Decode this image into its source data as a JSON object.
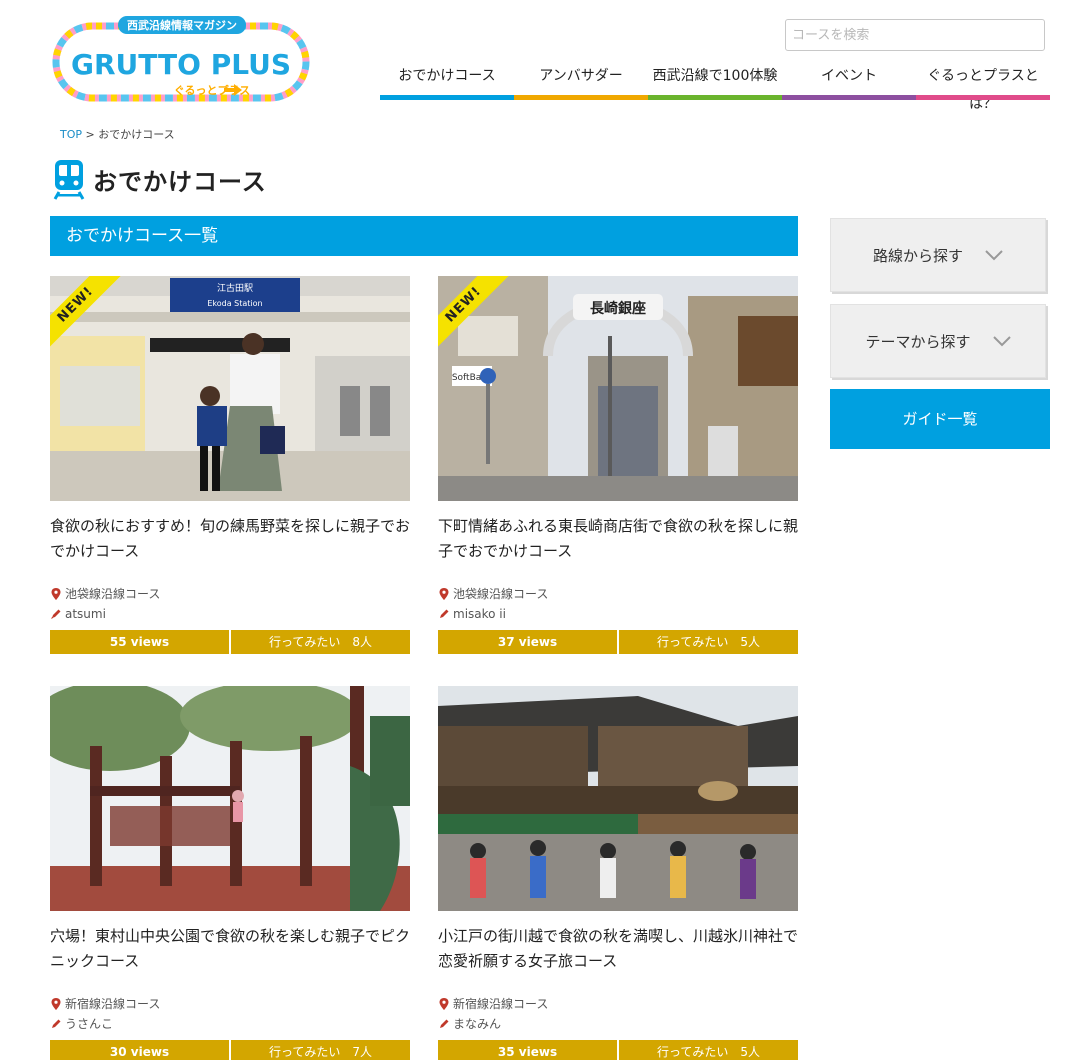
{
  "header": {
    "logo_tagline": "西武沿線情報マガジン",
    "logo_main": "GRUTTO PLUS",
    "logo_sub": "ぐるっとプラス",
    "search_placeholder": "コースを検索"
  },
  "nav": {
    "items": [
      {
        "label": "おでかけコース",
        "color": "#00a0e0"
      },
      {
        "label": "アンバサダー",
        "color": "#f0a800"
      },
      {
        "label": "西武沿線で100体験",
        "color": "#6ab42d"
      },
      {
        "label": "イベント",
        "color": "#8d4fa0"
      },
      {
        "label": "ぐるっとプラスとは？",
        "color": "#e04b8a"
      }
    ]
  },
  "breadcrumb": {
    "top": "TOP",
    "separator": ">",
    "current": "おでかけコース"
  },
  "page": {
    "title": "おでかけコース",
    "section_title": "おでかけコース一覧"
  },
  "cards": [
    {
      "title": "食欲の秋におすすめ！旬の練馬野菜を探しに親子でおでかけコース",
      "line": "池袋線沿線コース",
      "author": "atsumi",
      "views": "55 views",
      "want": "行ってみたい　8人",
      "badge": "NEW!"
    },
    {
      "title": "下町情緒あふれる東長崎商店街で食欲の秋を探しに親子でおでかけコース",
      "line": "池袋線沿線コース",
      "author": "misako ii",
      "views": "37 views",
      "want": "行ってみたい　5人",
      "badge": "NEW!"
    },
    {
      "title": "穴場！東村山中央公園で食欲の秋を楽しむ親子でピクニックコース",
      "line": "新宿線沿線コース",
      "author": "うさんこ",
      "views": "30 views",
      "want": "行ってみたい　7人"
    },
    {
      "title": "小江戸の街川越で食欲の秋を満喫し、川越氷川神社で恋愛祈願する女子旅コース",
      "line": "新宿線沿線コース",
      "author": "まなみん",
      "views": "35 views",
      "want": "行ってみたい　5人"
    }
  ],
  "photo_signs": {
    "station_sign": "江古田駅",
    "station_sub": "Ekoda Station",
    "arch_sign": "長崎銀座",
    "store_sign": "SoftBank"
  },
  "sidebar": {
    "route_label": "路線から探す",
    "theme_label": "テーマから探す",
    "guide_label": "ガイド一覧"
  },
  "colors": {
    "accent": "#00a0e0",
    "stat_gold": "#d3a600",
    "ribbon": "#f5e200"
  }
}
